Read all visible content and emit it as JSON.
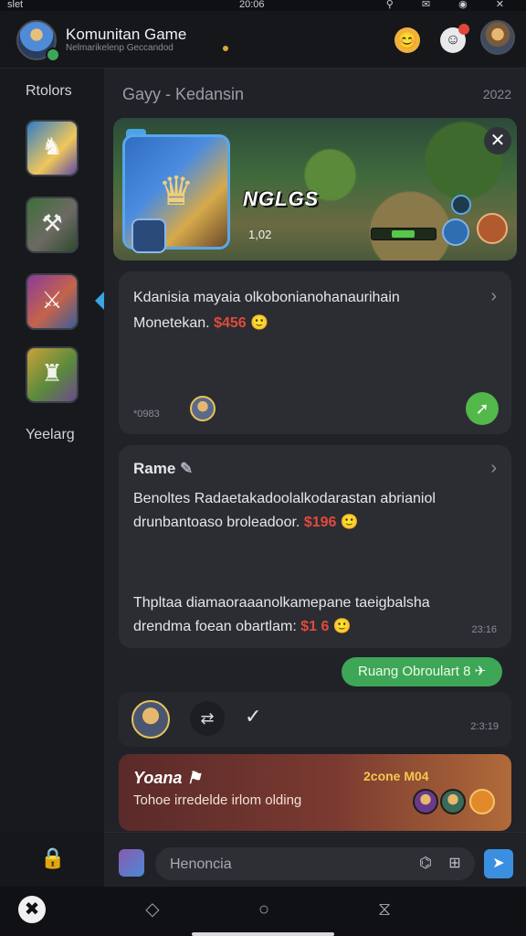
{
  "status_bar": {
    "signal": "slet",
    "time": "20:06",
    "icons": "⚲ ✉ ◉ ✕"
  },
  "header": {
    "title": "Komunitan Game",
    "subtitle": "Nelmarikelenp Geccandod"
  },
  "sidebar": {
    "title": "Rtolors",
    "footer": "Yeelarg",
    "items": [
      {
        "name": "game-hero-knight"
      },
      {
        "name": "game-hammer"
      },
      {
        "name": "game-warrior"
      },
      {
        "name": "game-mech"
      }
    ]
  },
  "main": {
    "title": "Gayy - Kedansin",
    "year": "2022",
    "banner": {
      "logo": "NGLGS",
      "score": "1,02",
      "hp_fraction": 0.55
    },
    "card1": {
      "line1": "Kdanisia mayaia olkobonianohanaurihain",
      "line2": "Monetekan.",
      "price": "$456",
      "emoji": "🙂",
      "time": "*0983"
    },
    "card2": {
      "name": "Rame",
      "line1": "Benoltes Radaetakadoolalkodarastan abrianiol",
      "line2": "drunbantoaso broleadoor.",
      "price": "$196",
      "emoji": "🙂",
      "line3": "Thpltaa diamaoraaanolkamepane taeigbalsha",
      "line4": "drendma foean obartlam:",
      "price2": "$1 6",
      "emoji2": "🙂",
      "time": "23:16"
    },
    "chip_label": "Ruang Obroulart 8 ✈",
    "actions_time": "2:3:19",
    "promo": {
      "title": "Yoana",
      "subtitle": "Tohoe irredelde irlom olding",
      "badge": "2cone M04"
    }
  },
  "composer": {
    "placeholder": "Henoncia"
  },
  "colors": {
    "accent": "#3aa5e6",
    "green": "#3ea657",
    "price": "#e24a3a",
    "promo_gold": "#f3c850"
  }
}
